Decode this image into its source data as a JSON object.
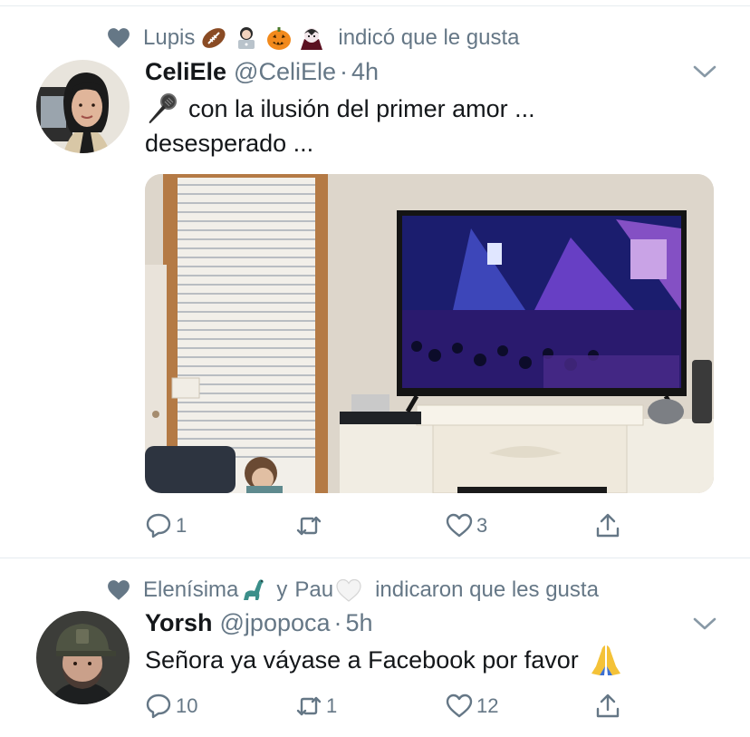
{
  "colors": {
    "text_primary": "#14171a",
    "text_secondary": "#657786",
    "divider": "#e6ecf0"
  },
  "tweets": [
    {
      "social_context": {
        "icon": "heart-icon",
        "name": "Lupis",
        "emojis": [
          "football-emoji",
          "technologist-emoji",
          "jack-o-lantern-emoji",
          "vampire-emoji"
        ],
        "verb": "indicó que le gusta"
      },
      "author": {
        "display_name": "CeliEle",
        "handle": "@CeliEle",
        "separator": "·",
        "time": "4h"
      },
      "text_lines": [
        "con la ilusión del primer amor ...",
        "desesperado ..."
      ],
      "text_emoji": "microphone-emoji",
      "media": {
        "description_icon": "photo-of-living-room-tv-concert"
      },
      "actions": {
        "reply": "1",
        "retweet": "",
        "like": "3"
      }
    },
    {
      "social_context": {
        "icon": "heart-icon",
        "name": "Elenísima",
        "name_emoji": "sauropod-emoji",
        "conj": "y",
        "name2": "Pau",
        "name2_emoji": "white-heart-emoji",
        "verb": "indicaron que les gusta"
      },
      "author": {
        "display_name": "Yorsh",
        "handle": "@jpopoca",
        "separator": "·",
        "time": "5h"
      },
      "text": "Señora ya váyase a Facebook por favor",
      "text_emoji": "folded-hands-emoji",
      "actions": {
        "reply": "10",
        "retweet": "1",
        "like": "12"
      }
    }
  ]
}
